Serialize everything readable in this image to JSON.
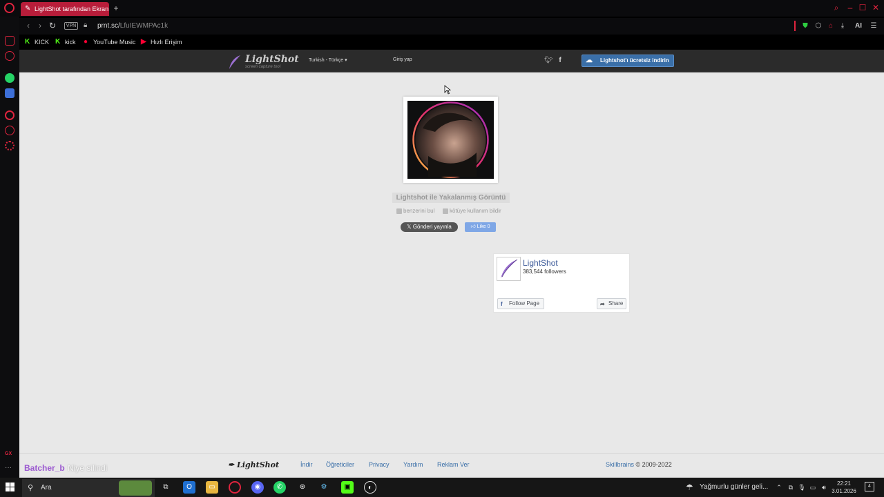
{
  "browser": {
    "tab_title": "LightShot tarafından Ekran",
    "new_tab": "+",
    "vpn_label": "VPN",
    "url_host": "prnt.sc/",
    "url_path": "LfuIEWMPAc1k",
    "ai_label": "AI"
  },
  "bookmarks": [
    {
      "label": "KICK",
      "color": "#53fc18"
    },
    {
      "label": "kick",
      "color": "#53fc18"
    },
    {
      "label": "YouTube Music",
      "color": "#ff0033"
    },
    {
      "label": "Hızlı Erişim",
      "color": "#ff0033"
    }
  ],
  "lightshot": {
    "brand": "LightShot",
    "tagline": "screen capture tool",
    "language": "Turkish - Türkçe ▾",
    "login": "Giriş yap",
    "download": "Lightshot'ı ücretsiz indirin",
    "caption": "Lightshot ile Yakalanmış Görüntü",
    "find_similar": "benzerini bul",
    "report_abuse": "kötüye kullanım bildir",
    "post_button": "Gönderi yayınla",
    "like_button": "Like 0"
  },
  "facebook_widget": {
    "page_name": "LightShot",
    "followers": "383,544 followers",
    "follow": "Follow Page",
    "share": "Share"
  },
  "footer": {
    "logo": "LightShot",
    "links": [
      "İndir",
      "Öğreticiler",
      "Privacy",
      "Yardım",
      "Reklam Ver"
    ],
    "company": "Skillbrains",
    "copyright": "© 2009-2022"
  },
  "stream_overlay": {
    "username": "Batcher_b",
    "message": "Niye silindi"
  },
  "taskbar": {
    "search_text": "Ara",
    "weather": "Yağmurlu günler geli...",
    "time": "22:21",
    "date": "3.01.2026",
    "notifications": "4"
  },
  "colors": {
    "opera_red": "#e0243e",
    "lightshot_blue": "#3a6fa8",
    "facebook_blue": "#3b5998"
  }
}
